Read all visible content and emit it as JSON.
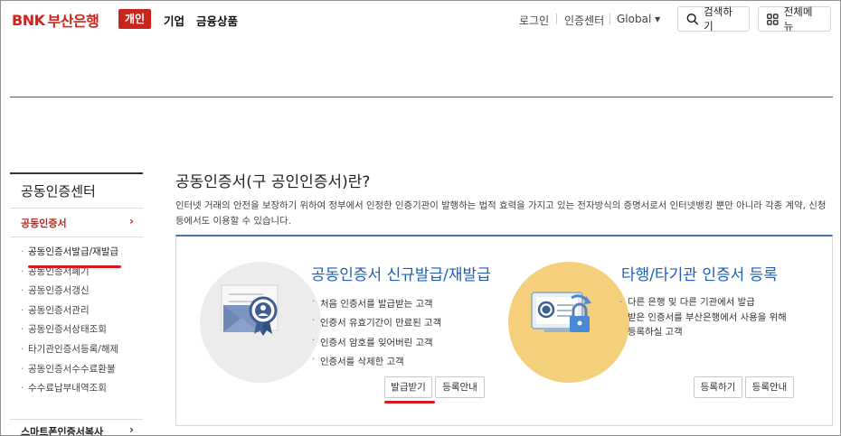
{
  "header": {
    "logo_mark": "BNK",
    "logo_text": "부산은행",
    "nav": [
      "개인",
      "기업",
      "금융상품"
    ],
    "utils": [
      "로그인",
      "인증센터",
      "Global ▾"
    ],
    "search_label": "검색하기",
    "menu_label": "전체메뉴"
  },
  "sidebar": {
    "title": "공동인증센터",
    "active": "공동인증서",
    "items": [
      "공동인증서발급/재발급",
      "공동인증서폐기",
      "공동인증서갱신",
      "공동인증서관리",
      "공동인증서상태조회",
      "타기관인증서등록/해제",
      "공동인증서수수료환불",
      "수수료납부내역조회"
    ],
    "more": "스마트폰인증서복사"
  },
  "main": {
    "title": "공동인증서(구 공인인증서)란?",
    "desc": "인터넷 거래의 안전을 보장하기 위하여 정부에서 인정한 인증기관이 발행하는 법적 효력을 가지고 있는 전자방식의 증명서로서 인터넷뱅킹 뿐만 아니라 각종 계약, 신청 등에서도 이용할 수 있습니다.",
    "card1": {
      "title": "공동인증서 신규발급/재발급",
      "bullets": [
        "처음 인증서를 발급받는 고객",
        "인증서 유효기간이 만료된 고객",
        "인증서 암호를 잊어버린 고객",
        "인증서를 삭제한 고객"
      ],
      "btn_issue": "발급받기",
      "btn_guide": "등록안내"
    },
    "card2": {
      "title": "타행/타기관 인증서 등록",
      "desc": "다른 은행 및 다른 기관에서 발급\n받은 인증서를 부산은행에서 사용을 위해\n등록하실 고객",
      "btn_register": "등록하기",
      "btn_guide": "등록안내"
    }
  },
  "colors": {
    "brand_red": "#c8261c",
    "title_blue": "#1e5fb4",
    "card_border_top": "#4a6fa8"
  }
}
